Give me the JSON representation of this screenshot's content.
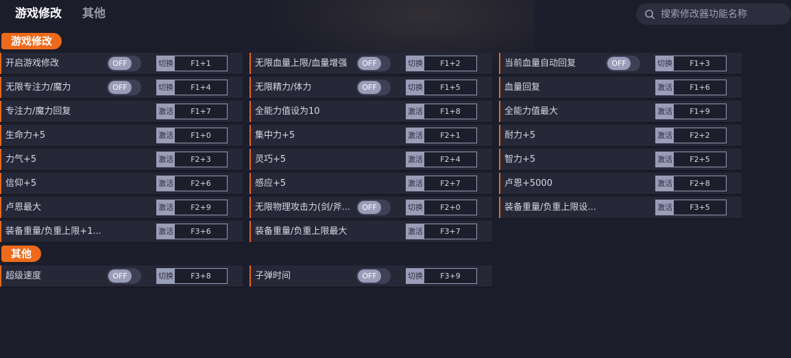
{
  "tabs": [
    {
      "label": "游戏修改",
      "active": true
    },
    {
      "label": "其他",
      "active": false
    }
  ],
  "search": {
    "placeholder": "搜索修改器功能名称"
  },
  "sections": [
    {
      "title": "游戏修改",
      "items": [
        {
          "name": "开启游戏修改",
          "toggle": "OFF",
          "action": "切换",
          "key": "F1+1"
        },
        {
          "name": "无限血量上限/血量增强",
          "toggle": "OFF",
          "action": "切换",
          "key": "F1+2"
        },
        {
          "name": "当前血量自动回复",
          "toggle": "OFF",
          "action": "切换",
          "key": "F1+3"
        },
        {
          "name": "无限专注力/魔力",
          "toggle": "OFF",
          "action": "切换",
          "key": "F1+4"
        },
        {
          "name": "无限精力/体力",
          "toggle": "OFF",
          "action": "切换",
          "key": "F1+5"
        },
        {
          "name": "血量回复",
          "toggle": null,
          "action": "激活",
          "key": "F1+6"
        },
        {
          "name": "专注力/魔力回复",
          "toggle": null,
          "action": "激活",
          "key": "F1+7"
        },
        {
          "name": "全能力值设为10",
          "toggle": null,
          "action": "激活",
          "key": "F1+8"
        },
        {
          "name": "全能力值最大",
          "toggle": null,
          "action": "激活",
          "key": "F1+9"
        },
        {
          "name": "生命力+5",
          "toggle": null,
          "action": "激活",
          "key": "F1+0"
        },
        {
          "name": "集中力+5",
          "toggle": null,
          "action": "激活",
          "key": "F2+1"
        },
        {
          "name": "耐力+5",
          "toggle": null,
          "action": "激活",
          "key": "F2+2"
        },
        {
          "name": "力气+5",
          "toggle": null,
          "action": "激活",
          "key": "F2+3"
        },
        {
          "name": "灵巧+5",
          "toggle": null,
          "action": "激活",
          "key": "F2+4"
        },
        {
          "name": "智力+5",
          "toggle": null,
          "action": "激活",
          "key": "F2+5"
        },
        {
          "name": "信仰+5",
          "toggle": null,
          "action": "激活",
          "key": "F2+6"
        },
        {
          "name": "感应+5",
          "toggle": null,
          "action": "激活",
          "key": "F2+7"
        },
        {
          "name": "卢恩+5000",
          "toggle": null,
          "action": "激活",
          "key": "F2+8"
        },
        {
          "name": "卢恩最大",
          "toggle": null,
          "action": "激活",
          "key": "F2+9"
        },
        {
          "name": "无限物理攻击力(剑/斧...",
          "toggle": "OFF",
          "action": "切换",
          "key": "F2+0"
        },
        {
          "name": "装备重量/负重上限设...",
          "toggle": null,
          "action": "激活",
          "key": "F3+5"
        },
        {
          "name": "装备重量/负重上限+1...",
          "toggle": null,
          "action": "激活",
          "key": "F3+6"
        },
        {
          "name": "装备重量/负重上限最大",
          "toggle": null,
          "action": "激活",
          "key": "F3+7"
        }
      ]
    },
    {
      "title": "其他",
      "items": [
        {
          "name": "超级速度",
          "toggle": "OFF",
          "action": "切换",
          "key": "F3+8"
        },
        {
          "name": "子弹时间",
          "toggle": "OFF",
          "action": "切换",
          "key": "F3+9"
        }
      ]
    }
  ],
  "colors": {
    "accent": "#ee6a1a",
    "background": "#1c1d2b",
    "card": "#262838",
    "chip": "#9a9db8"
  }
}
